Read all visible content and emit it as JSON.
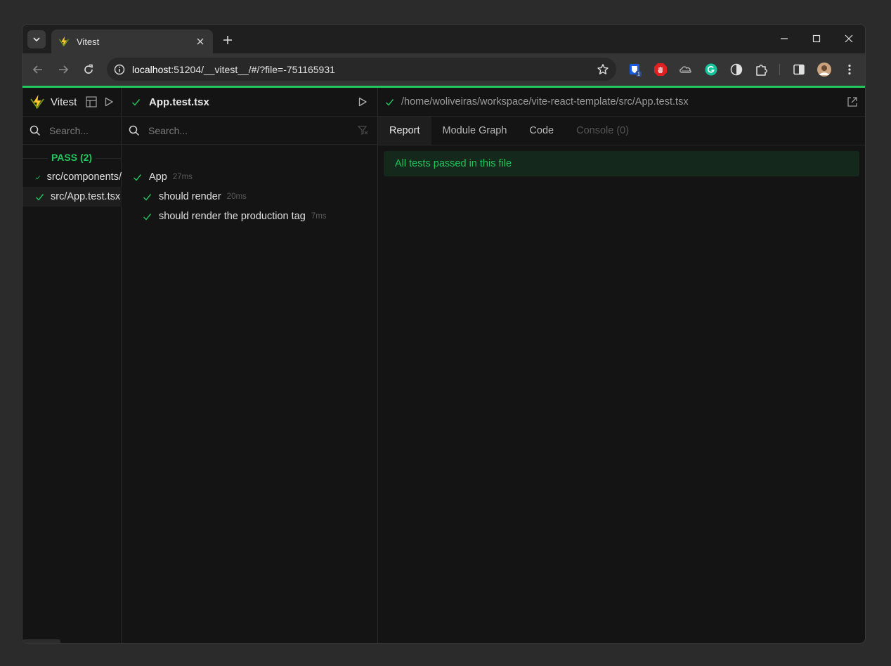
{
  "browser": {
    "tab_title": "Vitest",
    "url_host": "localhost",
    "url_rest": ":51204/__vitest__/#/?file=-751165931",
    "extension_badge": "1"
  },
  "sidebar": {
    "brand": "Vitest",
    "search_placeholder": "Search...",
    "pass_label": "PASS (2)",
    "files": [
      {
        "label": "src/components/",
        "status": "pass"
      },
      {
        "label": "src/App.test.tsx",
        "status": "pass"
      }
    ]
  },
  "tests_panel": {
    "file_name": "App.test.tsx",
    "search_placeholder": "Search...",
    "suite": {
      "label": "App",
      "duration": "27ms"
    },
    "tests": [
      {
        "label": "should render",
        "duration": "20ms"
      },
      {
        "label": "should render the production tag",
        "duration": "7ms"
      }
    ]
  },
  "detail_panel": {
    "path": "/home/woliveiras/workspace/vite-react-template/src/App.test.tsx",
    "tabs": [
      "Report",
      "Module Graph",
      "Code",
      "Console (0)"
    ],
    "active_tab": "Report",
    "banner": "All tests passed in this file"
  },
  "colors": {
    "accent": "#22c55e",
    "background": "#141414"
  }
}
